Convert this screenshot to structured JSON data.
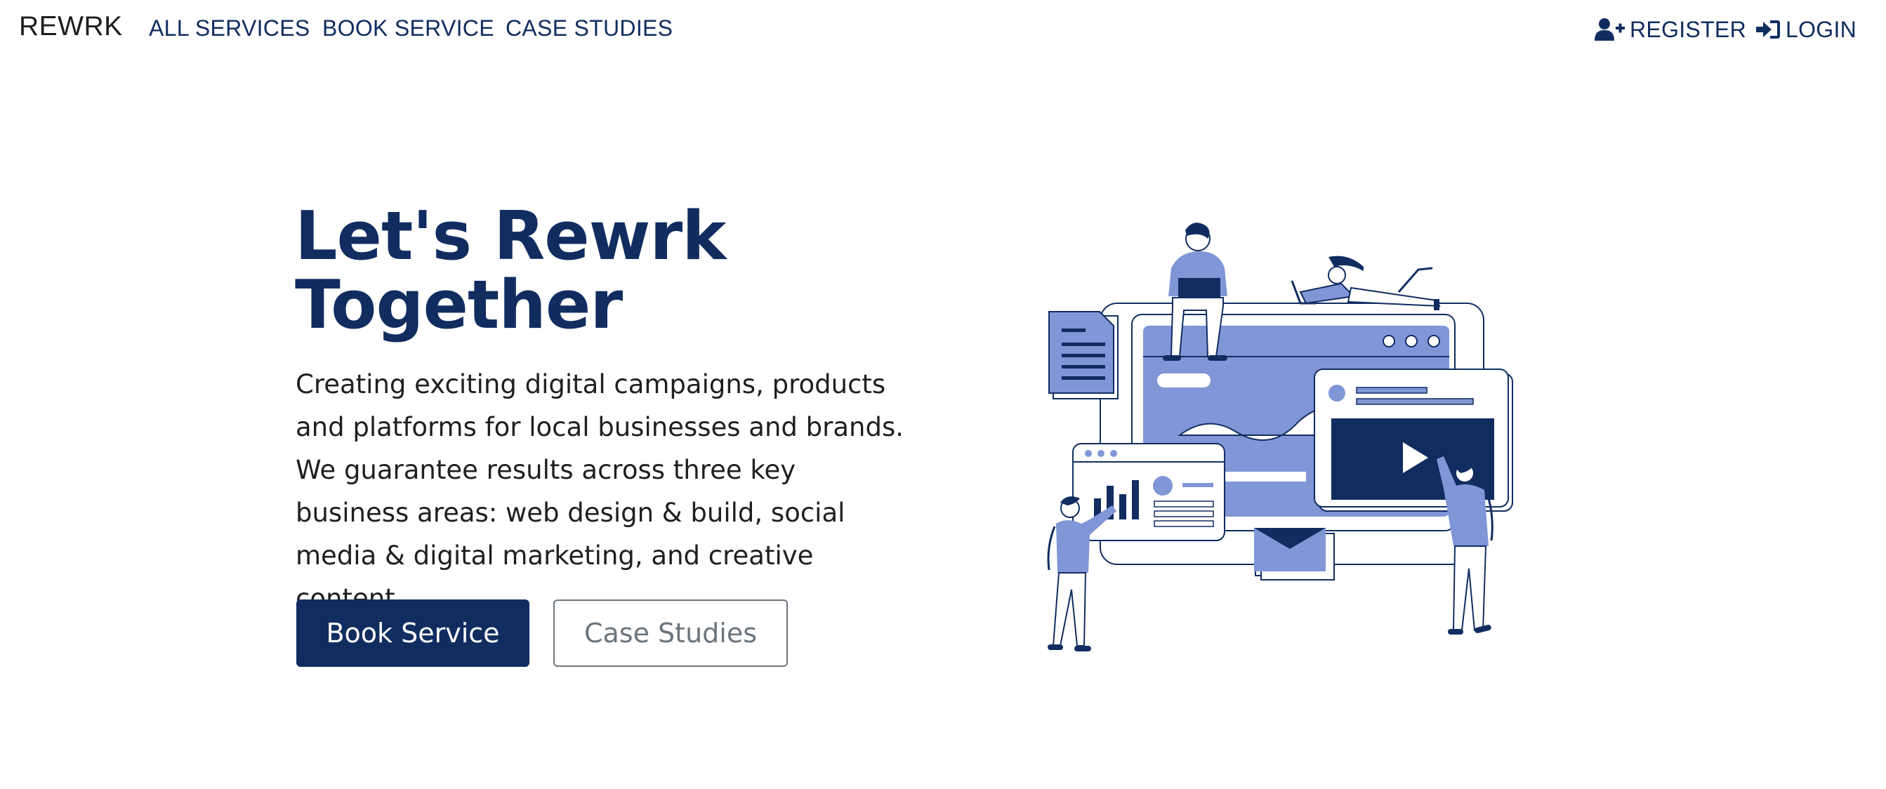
{
  "nav": {
    "brand": "REWRK",
    "links": [
      "ALL SERVICES",
      "BOOK SERVICE",
      "CASE STUDIES"
    ],
    "register": "REGISTER",
    "login": "LOGIN"
  },
  "hero": {
    "title_line1": "Let's Rewrk",
    "title_line2": "Together",
    "lead": "Creating exciting digital campaigns, products and platforms for local businesses and brands. We guarantee results across three key business areas: web design & build, social media & digital marketing, and creative content.",
    "primary_button": "Book Service",
    "secondary_button": "Case Studies"
  },
  "colors": {
    "primary": "#112d60",
    "accent": "#8196d6",
    "text": "#1f1f1f",
    "muted": "#6c757d"
  },
  "icons": {
    "register": "user-plus-icon",
    "login": "sign-in-icon",
    "illustration": "team-building-website-illustration"
  }
}
